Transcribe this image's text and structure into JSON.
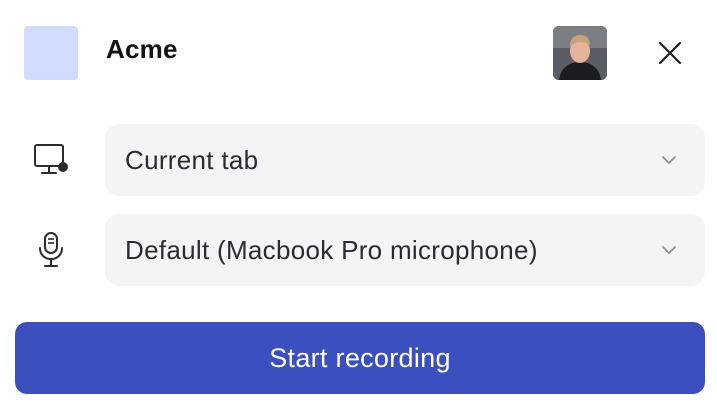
{
  "header": {
    "brand_name": "Acme",
    "logo_icon": "brand-logo-placeholder",
    "avatar_icon": "user-avatar",
    "close_icon": "close-icon"
  },
  "source": {
    "icon": "monitor-icon",
    "selected": "Current tab",
    "chevron_icon": "chevron-down-icon"
  },
  "microphone": {
    "icon": "microphone-icon",
    "selected": "Default (Macbook Pro microphone)",
    "chevron_icon": "chevron-down-icon"
  },
  "actions": {
    "start_label": "Start recording"
  },
  "colors": {
    "logo_bg": "#cfdcfd",
    "select_bg": "#f3f4f6",
    "primary": "#3b4fbf",
    "icon": "#2a2c31",
    "chevron": "#8c8f95"
  }
}
